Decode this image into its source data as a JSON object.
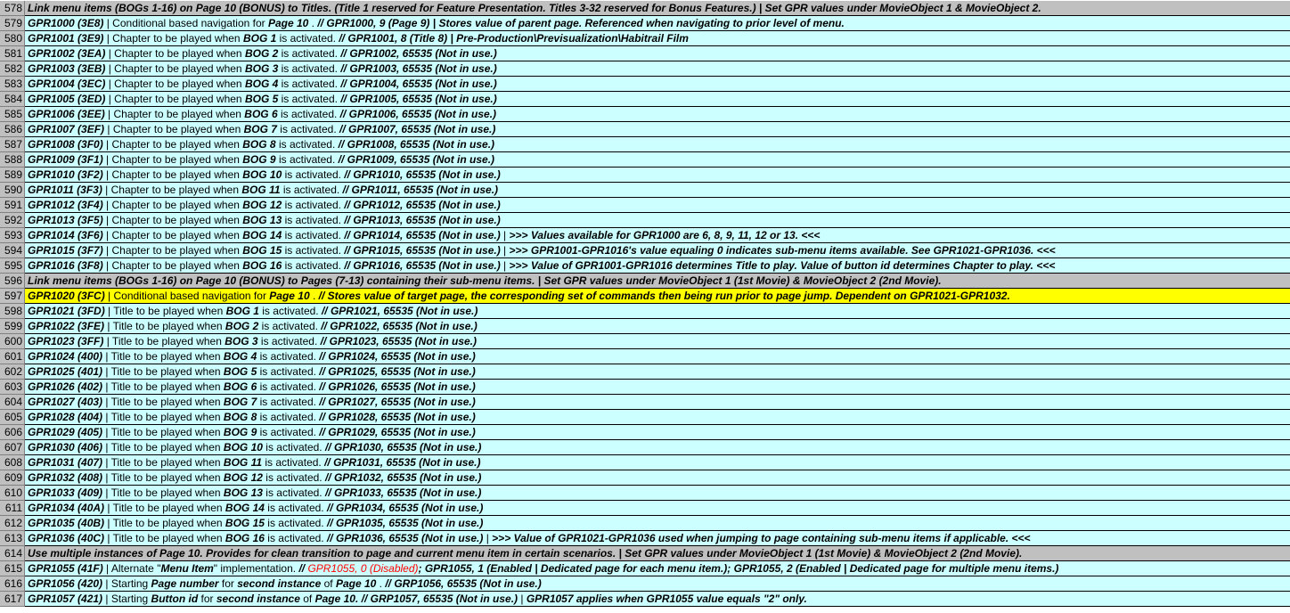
{
  "rows": [
    {
      "num": "578",
      "style": "gray",
      "parts": [
        {
          "t": "Link menu items (BOGs 1-16) on Page 10 (BONUS) to Titles. (Title 1 reserved for Feature Presentation. Titles 3-32 reserved for Bonus Features.)  |  Set GPR values under MovieObject 1 & MovieObject 2.",
          "b": 1
        }
      ]
    },
    {
      "num": "579",
      "style": "blue",
      "parts": [
        {
          "t": "GPR1000 (3E8)",
          "b": 1
        },
        {
          "t": "  |  Conditional based navigation for "
        },
        {
          "t": "Page 10",
          "b": 1
        },
        {
          "t": " . "
        },
        {
          "t": "// GPR1000, 9 (Page 9)  |  Stores value of parent page. Referenced when navigating to prior level of menu.",
          "b": 1
        }
      ]
    },
    {
      "num": "580",
      "style": "blue",
      "parts": [
        {
          "t": "GPR1001 (3E9)",
          "b": 1
        },
        {
          "t": "  |  Chapter to be played when "
        },
        {
          "t": "BOG 1",
          "b": 1
        },
        {
          "t": " is activated. "
        },
        {
          "t": "// GPR1001, 8 (Title 8)  |  Pre-Production\\Previsualization\\Habitrail Film",
          "b": 1
        }
      ]
    },
    {
      "num": "581",
      "style": "blue",
      "parts": [
        {
          "t": "GPR1002 (3EA)",
          "b": 1
        },
        {
          "t": "  |  Chapter to be played when "
        },
        {
          "t": "BOG 2",
          "b": 1
        },
        {
          "t": " is activated. "
        },
        {
          "t": "// GPR1002, 65535 (Not in use.)",
          "b": 1
        }
      ]
    },
    {
      "num": "582",
      "style": "blue",
      "parts": [
        {
          "t": "GPR1003 (3EB)",
          "b": 1
        },
        {
          "t": "  |  Chapter to be played when "
        },
        {
          "t": "BOG 3",
          "b": 1
        },
        {
          "t": " is activated. "
        },
        {
          "t": "// GPR1003, 65535 (Not in use.)",
          "b": 1
        }
      ]
    },
    {
      "num": "583",
      "style": "blue",
      "parts": [
        {
          "t": "GPR1004 (3EC)",
          "b": 1
        },
        {
          "t": "  |  Chapter to be played when "
        },
        {
          "t": "BOG 4",
          "b": 1
        },
        {
          "t": " is activated. "
        },
        {
          "t": "// GPR1004, 65535 (Not in use.)",
          "b": 1
        }
      ]
    },
    {
      "num": "584",
      "style": "blue",
      "parts": [
        {
          "t": "GPR1005 (3ED)",
          "b": 1
        },
        {
          "t": "  |  Chapter to be played when "
        },
        {
          "t": "BOG 5",
          "b": 1
        },
        {
          "t": " is activated. "
        },
        {
          "t": "// GPR1005, 65535 (Not in use.)",
          "b": 1
        }
      ]
    },
    {
      "num": "585",
      "style": "blue",
      "parts": [
        {
          "t": "GPR1006 (3EE)",
          "b": 1
        },
        {
          "t": "  |  Chapter to be played when "
        },
        {
          "t": "BOG 6",
          "b": 1
        },
        {
          "t": " is activated. "
        },
        {
          "t": "// GPR1006, 65535 (Not in use.)",
          "b": 1
        }
      ]
    },
    {
      "num": "586",
      "style": "blue",
      "parts": [
        {
          "t": "GPR1007 (3EF)",
          "b": 1
        },
        {
          "t": "  |  Chapter to be played when "
        },
        {
          "t": "BOG 7",
          "b": 1
        },
        {
          "t": " is activated. "
        },
        {
          "t": "// GPR1007, 65535 (Not in use.)",
          "b": 1
        }
      ]
    },
    {
      "num": "587",
      "style": "blue",
      "parts": [
        {
          "t": "GPR1008 (3F0)",
          "b": 1
        },
        {
          "t": "  |  Chapter to be played when "
        },
        {
          "t": "BOG 8",
          "b": 1
        },
        {
          "t": " is activated. "
        },
        {
          "t": "// GPR1008, 65535 (Not in use.)",
          "b": 1
        }
      ]
    },
    {
      "num": "588",
      "style": "blue",
      "parts": [
        {
          "t": "GPR1009 (3F1)",
          "b": 1
        },
        {
          "t": "  |  Chapter to be played when "
        },
        {
          "t": "BOG 9",
          "b": 1
        },
        {
          "t": " is activated. "
        },
        {
          "t": "// GPR1009, 65535 (Not in use.)",
          "b": 1
        }
      ]
    },
    {
      "num": "589",
      "style": "blue",
      "parts": [
        {
          "t": "GPR1010 (3F2)",
          "b": 1
        },
        {
          "t": "  |  Chapter to be played when "
        },
        {
          "t": "BOG 10",
          "b": 1
        },
        {
          "t": " is activated. "
        },
        {
          "t": "// GPR1010, 65535 (Not in use.)",
          "b": 1
        }
      ]
    },
    {
      "num": "590",
      "style": "blue",
      "parts": [
        {
          "t": "GPR1011 (3F3)",
          "b": 1
        },
        {
          "t": "  |  Chapter to be played when "
        },
        {
          "t": "BOG 11",
          "b": 1
        },
        {
          "t": " is activated. "
        },
        {
          "t": "// GPR1011, 65535 (Not in use.)",
          "b": 1
        }
      ]
    },
    {
      "num": "591",
      "style": "blue",
      "parts": [
        {
          "t": "GPR1012 (3F4)",
          "b": 1
        },
        {
          "t": "  |  Chapter to be played when "
        },
        {
          "t": "BOG 12",
          "b": 1
        },
        {
          "t": " is activated. "
        },
        {
          "t": "// GPR1012, 65535 (Not in use.)",
          "b": 1
        }
      ]
    },
    {
      "num": "592",
      "style": "blue",
      "parts": [
        {
          "t": "GPR1013 (3F5)",
          "b": 1
        },
        {
          "t": "  |  Chapter to be played when "
        },
        {
          "t": "BOG 13",
          "b": 1
        },
        {
          "t": " is activated. "
        },
        {
          "t": "// GPR1013, 65535 (Not in use.)",
          "b": 1
        }
      ]
    },
    {
      "num": "593",
      "style": "blue",
      "parts": [
        {
          "t": "GPR1014 (3F6)",
          "b": 1
        },
        {
          "t": "  |  Chapter to be played when "
        },
        {
          "t": "BOG 14",
          "b": 1
        },
        {
          "t": " is activated. "
        },
        {
          "t": "// GPR1014, 65535 (Not in use.)",
          "b": 1
        },
        {
          "t": "  |  "
        },
        {
          "t": ">>> Values available for GPR1000 are 6, 8, 9, 11, 12 or 13. <<<",
          "b": 1
        }
      ]
    },
    {
      "num": "594",
      "style": "blue",
      "parts": [
        {
          "t": "GPR1015 (3F7)",
          "b": 1
        },
        {
          "t": "  |  Chapter to be played when "
        },
        {
          "t": "BOG 15",
          "b": 1
        },
        {
          "t": " is activated. "
        },
        {
          "t": "// GPR1015, 65535 (Not in use.)",
          "b": 1
        },
        {
          "t": "  |  "
        },
        {
          "t": ">>> GPR1001-GPR1016's value equaling 0 indicates sub-menu items available. See GPR1021-GPR1036. <<<",
          "b": 1
        }
      ]
    },
    {
      "num": "595",
      "style": "blue",
      "parts": [
        {
          "t": "GPR1016 (3F8)",
          "b": 1
        },
        {
          "t": "  |  Chapter to be played when "
        },
        {
          "t": "BOG 16",
          "b": 1
        },
        {
          "t": " is activated. "
        },
        {
          "t": "// GPR1016, 65535 (Not in use.)",
          "b": 1
        },
        {
          "t": "  |  "
        },
        {
          "t": ">>> Value of GPR1001-GPR1016 determines Title to play. Value of button id determines Chapter to play. <<<",
          "b": 1
        }
      ]
    },
    {
      "num": "596",
      "style": "gray",
      "parts": [
        {
          "t": "Link menu items (BOGs 1-16) on Page 10 (BONUS) to Pages (7-13) containing their sub-menu items.  |  Set GPR values under MovieObject 1 (1st Movie) & MovieObject 2 (2nd Movie).",
          "b": 1
        }
      ]
    },
    {
      "num": "597",
      "style": "yellow",
      "parts": [
        {
          "t": "GPR1020 (3FC)",
          "b": 1
        },
        {
          "t": "  |  Conditional based navigation for "
        },
        {
          "t": "Page 10",
          "b": 1
        },
        {
          "t": " . "
        },
        {
          "t": "// Stores value of target page, the corresponding set of commands then being run prior to page jump. Dependent on GPR1021-GPR1032.",
          "b": 1
        }
      ]
    },
    {
      "num": "598",
      "style": "blue",
      "parts": [
        {
          "t": "GPR1021 (3FD)",
          "b": 1
        },
        {
          "t": "  |  Title to be played when "
        },
        {
          "t": "BOG 1",
          "b": 1
        },
        {
          "t": " is activated. "
        },
        {
          "t": "// GPR1021, 65535 (Not in use.)",
          "b": 1
        }
      ]
    },
    {
      "num": "599",
      "style": "blue",
      "parts": [
        {
          "t": "GPR1022 (3FE)",
          "b": 1
        },
        {
          "t": "  |  Title to be played when "
        },
        {
          "t": "BOG 2",
          "b": 1
        },
        {
          "t": " is activated. "
        },
        {
          "t": "// GPR1022, 65535 (Not in use.)",
          "b": 1
        }
      ]
    },
    {
      "num": "600",
      "style": "blue",
      "parts": [
        {
          "t": "GPR1023 (3FF)",
          "b": 1
        },
        {
          "t": "  |  Title to be played when "
        },
        {
          "t": "BOG 3",
          "b": 1
        },
        {
          "t": " is activated. "
        },
        {
          "t": "// GPR1023, 65535 (Not in use.)",
          "b": 1
        }
      ]
    },
    {
      "num": "601",
      "style": "blue",
      "parts": [
        {
          "t": "GPR1024 (400)",
          "b": 1
        },
        {
          "t": "  |  Title to be played when "
        },
        {
          "t": "BOG 4",
          "b": 1
        },
        {
          "t": " is activated. "
        },
        {
          "t": "// GPR1024, 65535 (Not in use.)",
          "b": 1
        }
      ]
    },
    {
      "num": "602",
      "style": "blue",
      "parts": [
        {
          "t": "GPR1025 (401)",
          "b": 1
        },
        {
          "t": "  |  Title to be played when "
        },
        {
          "t": "BOG 5",
          "b": 1
        },
        {
          "t": " is activated. "
        },
        {
          "t": "// GPR1025, 65535 (Not in use.)",
          "b": 1
        }
      ]
    },
    {
      "num": "603",
      "style": "blue",
      "parts": [
        {
          "t": "GPR1026 (402)",
          "b": 1
        },
        {
          "t": "  |  Title to be played when "
        },
        {
          "t": "BOG 6",
          "b": 1
        },
        {
          "t": " is activated. "
        },
        {
          "t": "// GPR1026, 65535 (Not in use.)",
          "b": 1
        }
      ]
    },
    {
      "num": "604",
      "style": "blue",
      "parts": [
        {
          "t": "GPR1027 (403)",
          "b": 1
        },
        {
          "t": "  |  Title to be played when "
        },
        {
          "t": "BOG 7",
          "b": 1
        },
        {
          "t": " is activated. "
        },
        {
          "t": "// GPR1027, 65535 (Not in use.)",
          "b": 1
        }
      ]
    },
    {
      "num": "605",
      "style": "blue",
      "parts": [
        {
          "t": "GPR1028 (404)",
          "b": 1
        },
        {
          "t": "  |  Title to be played when "
        },
        {
          "t": "BOG 8",
          "b": 1
        },
        {
          "t": " is activated. "
        },
        {
          "t": "// GPR1028, 65535 (Not in use.)",
          "b": 1
        }
      ]
    },
    {
      "num": "606",
      "style": "blue",
      "parts": [
        {
          "t": "GPR1029 (405)",
          "b": 1
        },
        {
          "t": "  |  Title to be played when "
        },
        {
          "t": "BOG 9",
          "b": 1
        },
        {
          "t": " is activated. "
        },
        {
          "t": "// GPR1029, 65535 (Not in use.)",
          "b": 1
        }
      ]
    },
    {
      "num": "607",
      "style": "blue",
      "parts": [
        {
          "t": "GPR1030 (406)",
          "b": 1
        },
        {
          "t": "  |  Title to be played when "
        },
        {
          "t": "BOG 10",
          "b": 1
        },
        {
          "t": " is activated. "
        },
        {
          "t": "// GPR1030, 65535 (Not in use.)",
          "b": 1
        }
      ]
    },
    {
      "num": "608",
      "style": "blue",
      "parts": [
        {
          "t": "GPR1031 (407)",
          "b": 1
        },
        {
          "t": "  |  Title to be played when "
        },
        {
          "t": "BOG 11",
          "b": 1
        },
        {
          "t": " is activated. "
        },
        {
          "t": "// GPR1031, 65535 (Not in use.)",
          "b": 1
        }
      ]
    },
    {
      "num": "609",
      "style": "blue",
      "parts": [
        {
          "t": "GPR1032 (408)",
          "b": 1
        },
        {
          "t": "  |  Title to be played when "
        },
        {
          "t": "BOG 12",
          "b": 1
        },
        {
          "t": " is activated. "
        },
        {
          "t": "// GPR1032, 65535 (Not in use.)",
          "b": 1
        }
      ]
    },
    {
      "num": "610",
      "style": "blue",
      "parts": [
        {
          "t": "GPR1033 (409)",
          "b": 1
        },
        {
          "t": "  |  Title to be played when "
        },
        {
          "t": "BOG 13",
          "b": 1
        },
        {
          "t": " is activated. "
        },
        {
          "t": "// GPR1033, 65535 (Not in use.)",
          "b": 1
        }
      ]
    },
    {
      "num": "611",
      "style": "blue",
      "parts": [
        {
          "t": "GPR1034 (40A)",
          "b": 1
        },
        {
          "t": "  |  Title to be played when "
        },
        {
          "t": "BOG 14",
          "b": 1
        },
        {
          "t": " is activated. "
        },
        {
          "t": "// GPR1034, 65535 (Not in use.)",
          "b": 1
        }
      ]
    },
    {
      "num": "612",
      "style": "blue",
      "parts": [
        {
          "t": "GPR1035 (40B)",
          "b": 1
        },
        {
          "t": "  |  Title to be played when "
        },
        {
          "t": "BOG 15",
          "b": 1
        },
        {
          "t": " is activated. "
        },
        {
          "t": "// GPR1035, 65535 (Not in use.)",
          "b": 1
        }
      ]
    },
    {
      "num": "613",
      "style": "blue",
      "parts": [
        {
          "t": "GPR1036 (40C)",
          "b": 1
        },
        {
          "t": "  |  Title to be played when "
        },
        {
          "t": "BOG 16",
          "b": 1
        },
        {
          "t": " is activated. "
        },
        {
          "t": "// GPR1036, 65535 (Not in use.)",
          "b": 1
        },
        {
          "t": "  |  "
        },
        {
          "t": ">>> Value of GPR1021-GPR1036 used when jumping to page containing sub-menu items if applicable. <<<",
          "b": 1
        }
      ]
    },
    {
      "num": "614",
      "style": "gray",
      "parts": [
        {
          "t": "Use multiple instances of Page 10. Provides for clean transition to page and current menu item in certain scenarios.  |  Set GPR values under MovieObject 1 (1st Movie) & MovieObject 2 (2nd Movie).",
          "b": 1
        }
      ]
    },
    {
      "num": "615",
      "style": "blue",
      "parts": [
        {
          "t": "GPR1055 (41F)",
          "b": 1
        },
        {
          "t": "  |  Alternate \""
        },
        {
          "t": "Menu Item",
          "b": 1
        },
        {
          "t": "\" implementation. "
        },
        {
          "t": "// ",
          "b": 1
        },
        {
          "t": "GPR1055, 0 (Disabled)",
          "r": 1
        },
        {
          "t": "; GPR1055, 1 (Enabled | Dedicated page for each menu item.); GPR1055, 2 (Enabled | Dedicated page for multiple menu items.)",
          "b": 1
        }
      ]
    },
    {
      "num": "616",
      "style": "blue",
      "parts": [
        {
          "t": "GPR1056 (420)",
          "b": 1
        },
        {
          "t": "  |  Starting "
        },
        {
          "t": "Page number",
          "b": 1
        },
        {
          "t": " for "
        },
        {
          "t": "second instance",
          "b": 1
        },
        {
          "t": " of "
        },
        {
          "t": "Page 10",
          "b": 1
        },
        {
          "t": " . "
        },
        {
          "t": "// GRP1056, 65535 (Not in use.)",
          "b": 1
        }
      ]
    },
    {
      "num": "617",
      "style": "blue",
      "parts": [
        {
          "t": "GPR1057 (421)",
          "b": 1
        },
        {
          "t": "  |  Starting "
        },
        {
          "t": "Button id",
          "b": 1
        },
        {
          "t": " for "
        },
        {
          "t": "second instance",
          "b": 1
        },
        {
          "t": " of "
        },
        {
          "t": "Page 10.",
          "b": 1
        },
        {
          "t": " "
        },
        {
          "t": "// GRP1057, 65535 (Not in use.)",
          "b": 1
        },
        {
          "t": "  |  "
        },
        {
          "t": "GPR1057 applies when GPR1055 value equals \"2\" only.",
          "b": 1
        }
      ]
    }
  ]
}
